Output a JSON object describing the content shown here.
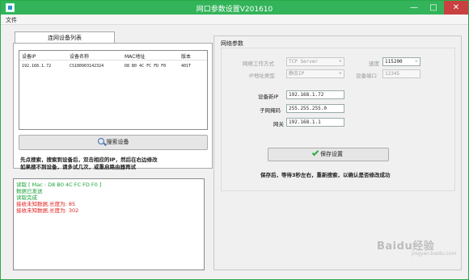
{
  "window": {
    "title": "网口参数设置V201610",
    "minimize": "—",
    "maximize": "□",
    "close": "✕"
  },
  "menu": {
    "file": "文件"
  },
  "left": {
    "tab_label": "连网设备列表",
    "table": {
      "headers": [
        "设备IP",
        "设备名称",
        "MAC地址",
        "版本"
      ],
      "rows": [
        [
          "192.168.1.72",
          "CS180903142324",
          "D8 B0 4C FC FD F0",
          "401T"
        ]
      ]
    },
    "search_button": "搜索设备",
    "hint_line1": "先点搜索，搜索到设备后，双击相应的IP，然后在右边修改",
    "hint_line2": "如果搜不到设备，请多试几次，或重启路由器再试"
  },
  "log": [
    {
      "text": "读取 [ Mac : D8 B0 4C FC FD F0 ]",
      "color": "green"
    },
    {
      "text": "数据已发送",
      "color": "green"
    },
    {
      "text": "读取完成",
      "color": "green"
    },
    {
      "text": "接收未知数据,长度为: 85",
      "color": "red"
    },
    {
      "text": "接收未知数据,长度为: 302",
      "color": "red"
    }
  ],
  "right": {
    "group_title": "网络参数",
    "work_mode_label": "网络工作方式",
    "work_mode_value": "TCP Server",
    "speed_label": "速度",
    "speed_value": "115200",
    "ip_type_label": "IP地址类型",
    "ip_type_value": "静态IP",
    "port_label": "设备端口",
    "port_value": "12345",
    "new_ip_label": "设备新IP",
    "new_ip_value": "192.168.1.72",
    "mask_label": "子网掩码",
    "mask_value": "255.255.255.0",
    "gateway_label": "网关",
    "gateway_value": "192.168.1.1",
    "save_button": "保存设置",
    "save_hint": "保存后，等待3秒左右，重新搜索，以确认是否修改成功"
  },
  "watermark": {
    "text": "Baidu经验",
    "sub": "jingyan.baidu.com"
  },
  "colors": {
    "titlebar": "#33b45a",
    "log_green": "#1aa33a",
    "log_red": "#e02020"
  }
}
